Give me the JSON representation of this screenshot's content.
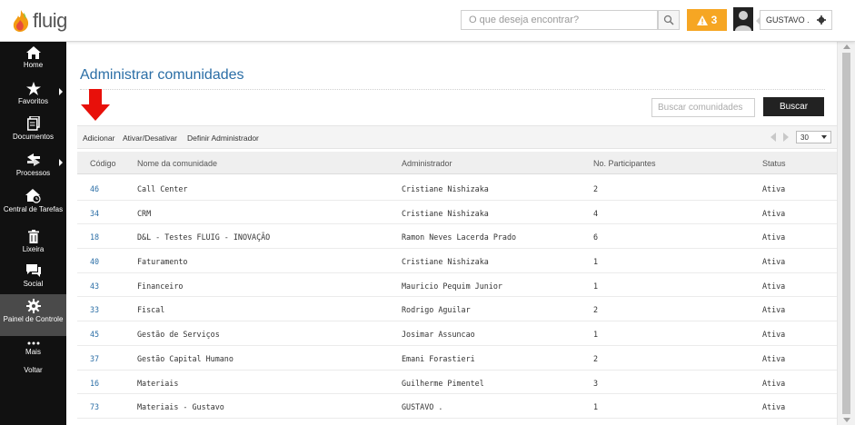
{
  "app": {
    "logo_text": "fluig"
  },
  "header": {
    "search_placeholder": "O que deseja encontrar?",
    "alert_count": "3",
    "user_name": "GUSTAVO ."
  },
  "sidebar": {
    "items": [
      {
        "label": "Home",
        "icon": "home-icon"
      },
      {
        "label": "Favoritos",
        "icon": "star-icon"
      },
      {
        "label": "Documentos",
        "icon": "documents-icon"
      },
      {
        "label": "Processos",
        "icon": "processes-icon"
      },
      {
        "label": "Central de Tarefas",
        "icon": "task-center-icon"
      },
      {
        "label": "Lixeira",
        "icon": "trash-icon"
      },
      {
        "label": "Social",
        "icon": "social-icon"
      },
      {
        "label": "Painel de Controle",
        "icon": "control-panel-icon"
      },
      {
        "label": "Mais",
        "icon": "more-icon"
      },
      {
        "label": "Voltar"
      }
    ]
  },
  "page": {
    "title": "Administrar comunidades",
    "search_placeholder": "Buscar comunidades",
    "search_button": "Buscar",
    "actions": {
      "add": "Adicionar",
      "toggle": "Ativar/Desativar",
      "set_admin": "Definir Administrador"
    },
    "page_size": "30"
  },
  "table": {
    "columns": [
      "Código",
      "Nome da comunidade",
      "Administrador",
      "No. Participantes",
      "Status"
    ],
    "rows": [
      [
        "46",
        "Call Center",
        "Cristiane Nishizaka",
        "2",
        "Ativa"
      ],
      [
        "34",
        "CRM",
        "Cristiane Nishizaka",
        "4",
        "Ativa"
      ],
      [
        "18",
        "D&L - Testes FLUIG - INOVAÇÃO",
        "Ramon Neves Lacerda Prado",
        "6",
        "Ativa"
      ],
      [
        "40",
        "Faturamento",
        "Cristiane Nishizaka",
        "1",
        "Ativa"
      ],
      [
        "43",
        "Financeiro",
        "Mauricio Pequim Junior",
        "1",
        "Ativa"
      ],
      [
        "33",
        "Fiscal",
        "Rodrigo Aguilar",
        "2",
        "Ativa"
      ],
      [
        "45",
        "Gestão de Serviços",
        "Josimar Assuncao",
        "1",
        "Ativa"
      ],
      [
        "37",
        "Gestão Capital Humano",
        "Emani Forastieri",
        "2",
        "Ativa"
      ],
      [
        "16",
        "Materiais",
        "Guilherme Pimentel",
        "3",
        "Ativa"
      ],
      [
        "73",
        "Materiais - Gustavo",
        "GUSTAVO .",
        "1",
        "Ativa"
      ]
    ]
  },
  "colors": {
    "accent": "#2b6ea6",
    "alert": "#f6a623",
    "sidebar": "#111111",
    "annotation_arrow": "#e8100a"
  }
}
